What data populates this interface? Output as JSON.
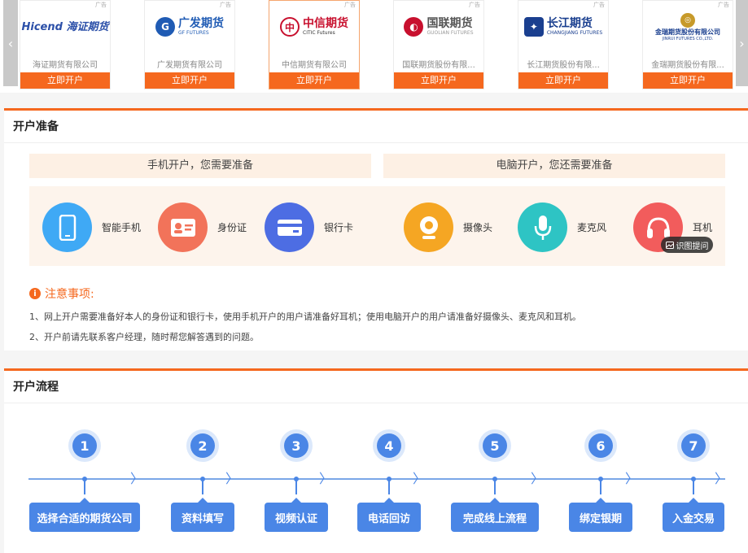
{
  "carousel": {
    "left_arrow_glyph": "‹",
    "right_arrow_glyph": "›",
    "ad_label": "广告",
    "brokers": [
      {
        "logo_cn": "Hicend 海证期货",
        "logo_en": "",
        "name": "海证期货有限公司",
        "button": "立即开户",
        "color": "#2b4fa8"
      },
      {
        "logo_cn": "广发期货",
        "logo_en": "GF FUTURES",
        "name": "广发期货有限公司",
        "button": "立即开户",
        "color": "#1f5bb4"
      },
      {
        "logo_cn": "中信期货",
        "logo_en": "CITIC Futures",
        "name": "中信期货有限公司",
        "button": "立即开户",
        "color": "#c8102e"
      },
      {
        "logo_cn": "国联期货",
        "logo_en": "GUOLIAN FUTURES",
        "name": "国联期货股份有限...",
        "button": "立即开户",
        "color": "#c8102e"
      },
      {
        "logo_cn": "长江期货",
        "logo_en": "CHANGJIANG FUTURES",
        "name": "长江期货股份有限...",
        "button": "立即开户",
        "color": "#1a3f8f"
      },
      {
        "logo_cn": "金瑞期货股份有限公司",
        "logo_en": "JINRUI FUTURES CO.,LTD.",
        "name": "金瑞期货股份有限...",
        "button": "立即开户",
        "color": "#1a3f8f"
      }
    ]
  },
  "prep": {
    "title": "开户准备",
    "mobile_head": "手机开户，您需要准备",
    "pc_head": "电脑开户，您还需要准备",
    "items": [
      {
        "label": "智能手机",
        "icon": "phone-icon",
        "color": "#3fa9f5"
      },
      {
        "label": "身份证",
        "icon": "id-card-icon",
        "color": "#f2735a"
      },
      {
        "label": "银行卡",
        "icon": "bank-card-icon",
        "color": "#4d6de3"
      },
      {
        "label": "摄像头",
        "icon": "camera-icon",
        "color": "#f5a623"
      },
      {
        "label": "麦克风",
        "icon": "microphone-icon",
        "color": "#2ec4c4"
      },
      {
        "label": "耳机",
        "icon": "headphone-icon",
        "color": "#f25c5c"
      }
    ],
    "chat_label": "识图提问",
    "notice_title": "注意事项:",
    "notice_icon": "i",
    "notices": [
      "1、网上开户需要准备好本人的身份证和银行卡，使用手机开户的用户请准备好耳机；使用电脑开户的用户请准备好摄像头、麦克风和耳机。",
      "2、开户前请先联系客户经理，随时帮您解答遇到的问题。"
    ]
  },
  "flow": {
    "title": "开户流程",
    "steps": [
      {
        "num": "1",
        "label": "选择合适的期货公司"
      },
      {
        "num": "2",
        "label": "资料填写"
      },
      {
        "num": "3",
        "label": "视频认证"
      },
      {
        "num": "4",
        "label": "电话回访"
      },
      {
        "num": "5",
        "label": "完成线上流程"
      },
      {
        "num": "6",
        "label": "绑定银期"
      },
      {
        "num": "7",
        "label": "入金交易"
      }
    ],
    "arrow_glyph": "〉"
  }
}
